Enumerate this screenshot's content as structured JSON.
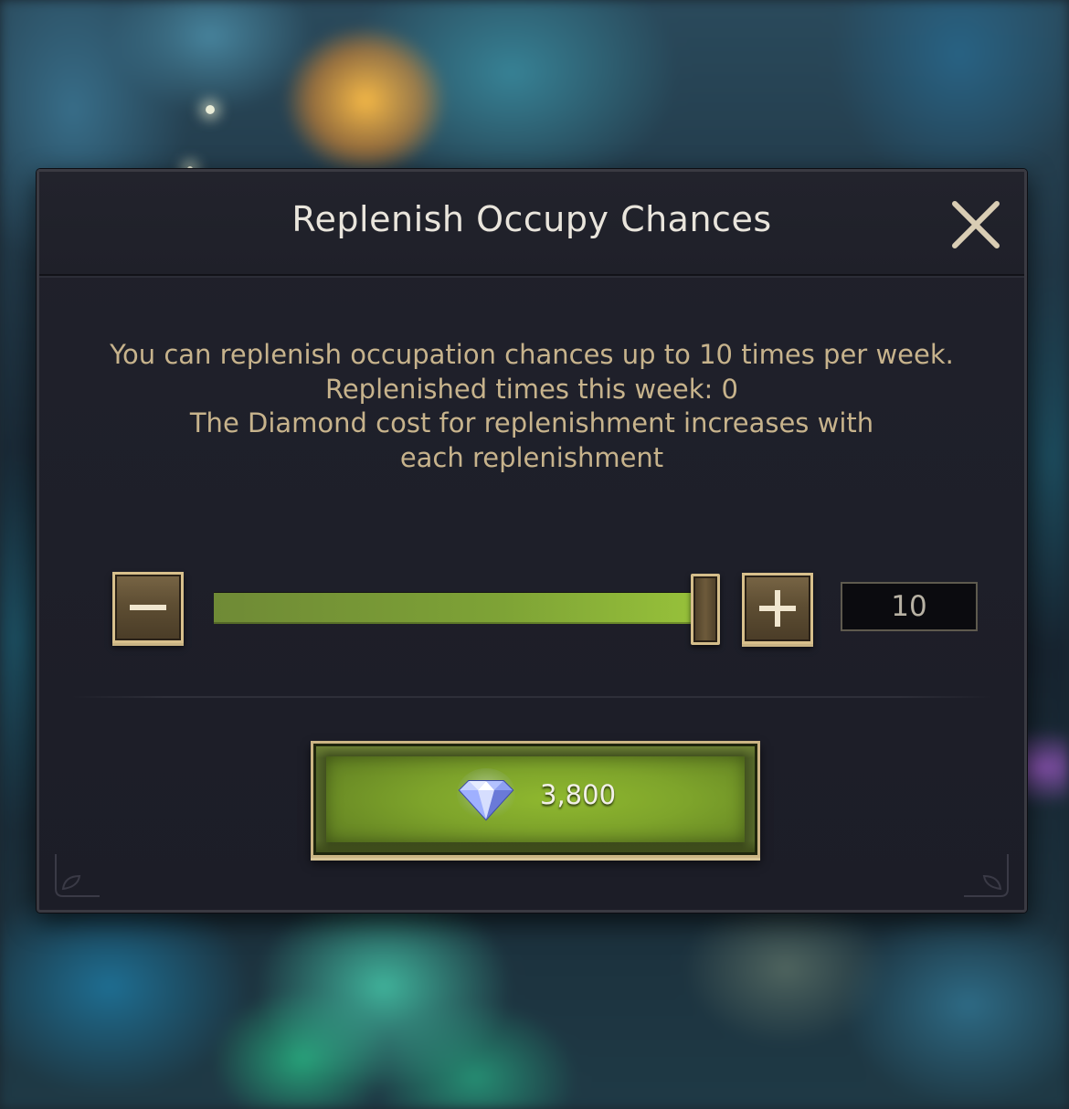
{
  "dialog": {
    "title": "Replenish Occupy Chances",
    "info_lines": [
      "You can replenish occupation chances up to 10 times per week.",
      "Replenished times this week: 0",
      "The Diamond cost for replenishment increases with each replenishment"
    ]
  },
  "slider": {
    "value": 10,
    "min": 0,
    "max": 10,
    "fill_fraction": 1.0,
    "quantity_text": "10"
  },
  "buy_button": {
    "price": "3,800",
    "currency_icon": "diamond-icon"
  },
  "icons": {
    "close": "close-icon",
    "minus": "minus-icon",
    "plus": "plus-icon"
  },
  "colors": {
    "accent_gold": "#d8c08c",
    "button_green": "#8fb82f",
    "info_text": "#c7b38c",
    "title_text": "#e9e5dc"
  }
}
